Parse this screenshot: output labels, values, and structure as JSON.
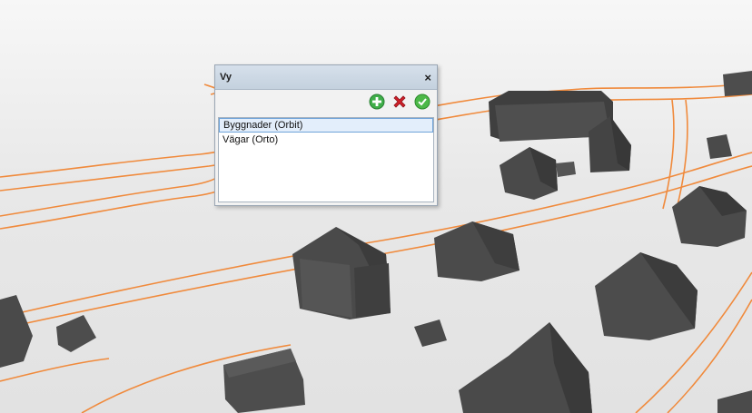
{
  "scene": {
    "road_color": "#f08a3c",
    "building_color": "#4d4d4d",
    "ground_color": "#e8e8e8"
  },
  "panel": {
    "title": "Vy",
    "close_glyph": "×",
    "toolbar": {
      "add_icon": "add-icon",
      "remove_icon": "remove-icon",
      "confirm_icon": "confirm-icon"
    },
    "layers": [
      {
        "label": "Byggnader (Orbit)",
        "selected": true
      },
      {
        "label": "Vägar (Orto)",
        "selected": false
      }
    ]
  }
}
